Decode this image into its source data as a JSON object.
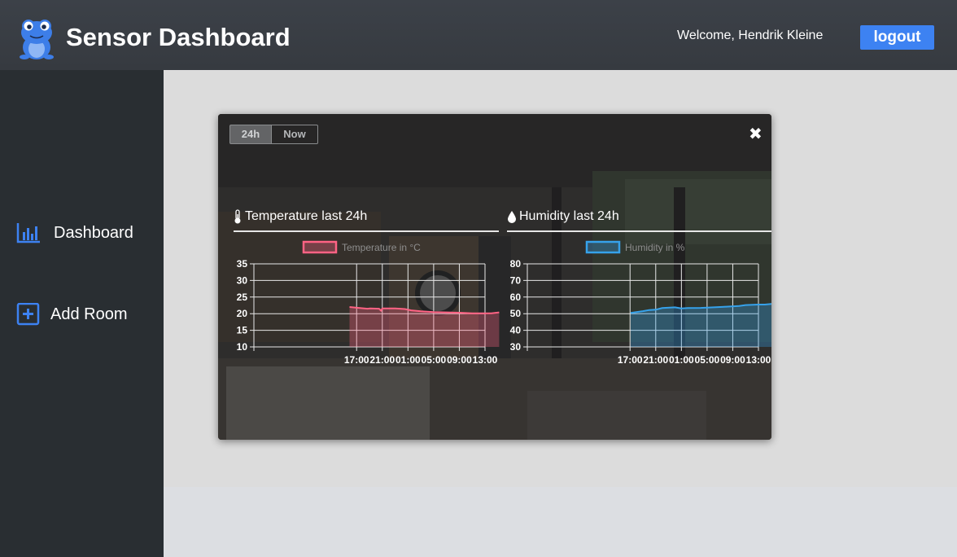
{
  "header": {
    "title": "Sensor Dashboard",
    "welcome": "Welcome, Hendrik Kleine",
    "logout_label": "logout"
  },
  "sidebar": {
    "items": [
      {
        "label": "Dashboard",
        "icon": "bar-chart-icon"
      },
      {
        "label": "Add Room",
        "icon": "plus-square-icon"
      }
    ]
  },
  "room_card": {
    "toggle": {
      "options": [
        "24h",
        "Now"
      ],
      "selected": "24h"
    },
    "close_icon": "close-icon",
    "temperature_title": "Temperature last 24h",
    "humidity_title": "Humidity last 24h"
  },
  "colors": {
    "accent": "#3d82f2",
    "temperature_line": "#ff6384",
    "humidity_line": "#36a2eb",
    "header_bg": "#3b4047",
    "sidebar_bg": "#292e32"
  },
  "chart_data": [
    {
      "type": "area",
      "legend": "Temperature in °C",
      "x": [
        "17:00",
        "21:00",
        "01:00",
        "05:00",
        "09:00",
        "13:00"
      ],
      "ylim": [
        10,
        35
      ],
      "yticks": [
        10,
        15,
        20,
        25,
        30,
        35
      ],
      "series": [
        {
          "name": "Temperature in °C",
          "points": [
            [
              15.9,
              22
            ],
            [
              17,
              21.8
            ],
            [
              18.7,
              21.5
            ],
            [
              19.1,
              21.6
            ],
            [
              20.5,
              21.5
            ],
            [
              20.8,
              20.9
            ],
            [
              21,
              21.6
            ],
            [
              23,
              21.6
            ],
            [
              24.5,
              21.4
            ],
            [
              25.5,
              21
            ],
            [
              27,
              20.7
            ],
            [
              29,
              20.5
            ],
            [
              31,
              20.4
            ],
            [
              33,
              20.3
            ],
            [
              35,
              20.1
            ],
            [
              37,
              20.1
            ],
            [
              38,
              20.1
            ],
            [
              39.2,
              20.4
            ]
          ]
        }
      ]
    },
    {
      "type": "area",
      "legend": "Humidity in %",
      "x": [
        "17:00",
        "21:00",
        "01:00",
        "05:00",
        "09:00",
        "13:00"
      ],
      "ylim": [
        30,
        80
      ],
      "yticks": [
        30,
        40,
        50,
        60,
        70,
        80
      ],
      "series": [
        {
          "name": "Humidity in %",
          "points": [
            [
              17.1,
              50.5
            ],
            [
              18,
              51
            ],
            [
              19,
              51.5
            ],
            [
              20,
              52.2
            ],
            [
              21,
              52.4
            ],
            [
              22,
              53.4
            ],
            [
              24,
              53.8
            ],
            [
              25,
              53.2
            ],
            [
              26,
              53.4
            ],
            [
              28,
              53.5
            ],
            [
              30,
              53.8
            ],
            [
              32,
              54.2
            ],
            [
              34,
              54.6
            ],
            [
              35,
              55.2
            ],
            [
              37,
              55.5
            ],
            [
              38,
              55.5
            ],
            [
              39,
              55.9
            ],
            [
              40,
              55.8
            ],
            [
              40.8,
              56.5
            ]
          ]
        }
      ]
    }
  ]
}
